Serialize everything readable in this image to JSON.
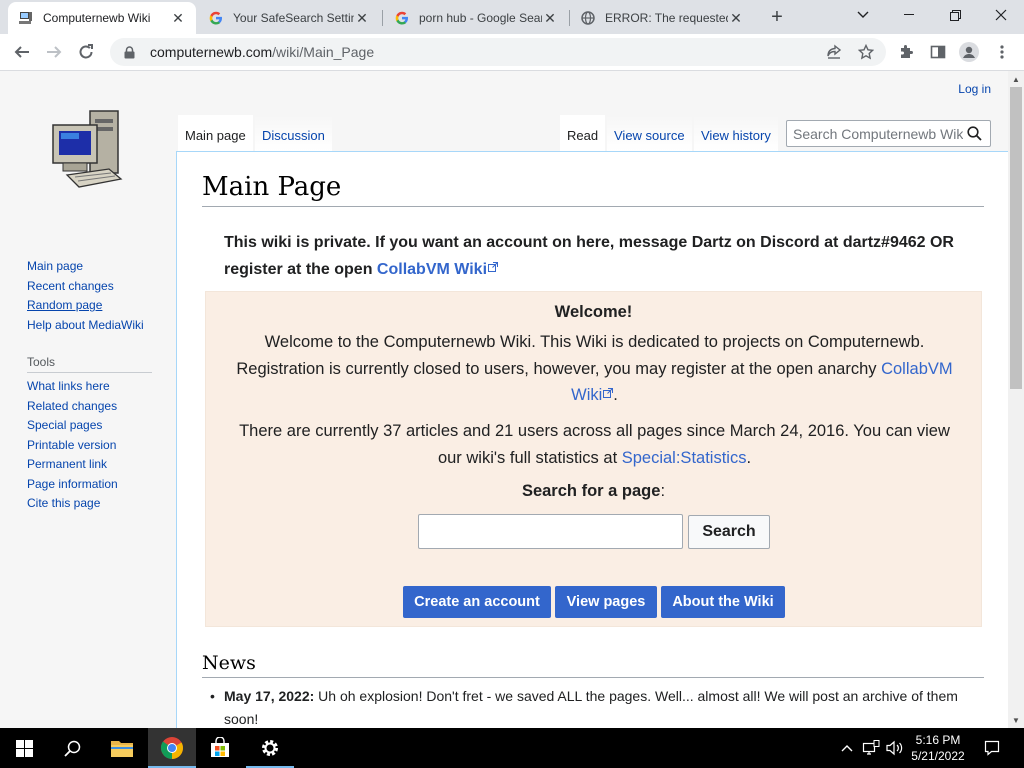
{
  "browser": {
    "tabs": [
      {
        "title": "Computernewb Wiki",
        "favicon": "computer-favicon"
      },
      {
        "title": "Your SafeSearch Settings",
        "favicon": "google-favicon"
      },
      {
        "title": "porn hub - Google Search",
        "favicon": "google-favicon"
      },
      {
        "title": "ERROR: The requested URL",
        "favicon": "globe-favicon"
      }
    ],
    "url_host": "computernewb.com",
    "url_path": "/wiki/Main_Page"
  },
  "page": {
    "login": "Log in",
    "tabs_left": [
      "Main page",
      "Discussion"
    ],
    "tabs_right": [
      "Read",
      "View source",
      "View history"
    ],
    "search_placeholder": "Search Computernewb Wiki",
    "sidebar": {
      "nav": [
        "Main page",
        "Recent changes",
        "Random page",
        "Help about MediaWiki"
      ],
      "tools_header": "Tools",
      "tools": [
        "What links here",
        "Related changes",
        "Special pages",
        "Printable version",
        "Permanent link",
        "Page information",
        "Cite this page"
      ]
    },
    "title": "Main Page",
    "notice_text": "This wiki is private. If you want an account on here, message Dartz on Discord at dartz#9462 OR register at the open ",
    "notice_link": "CollabVM Wiki",
    "welcome": {
      "heading": "Welcome!",
      "p1_text": "Welcome to the Computernewb Wiki. This Wiki is dedicated to projects on Computernewb. Registration is currently closed to users, however, you may register at the open anarchy ",
      "p1_link": "CollabVM Wiki",
      "p1_end": ".",
      "p2_text": "There are currently 37 articles and 21 users across all pages since March 24, 2016. You can view our wiki's full statistics at ",
      "p2_link": "Special:Statistics",
      "p2_end": ".",
      "search_label": "Search for a page",
      "search_colon": ":",
      "search_button": "Search",
      "buttons": [
        "Create an account",
        "View pages",
        "About the Wiki"
      ]
    },
    "news_heading": "News",
    "news_date": "May 17, 2022:",
    "news_text": " Uh oh explosion! Don't fret - we saved ALL the pages. Well... almost all! We will post an archive of them soon!"
  },
  "taskbar": {
    "time": "5:16 PM",
    "date": "5/21/2022"
  }
}
